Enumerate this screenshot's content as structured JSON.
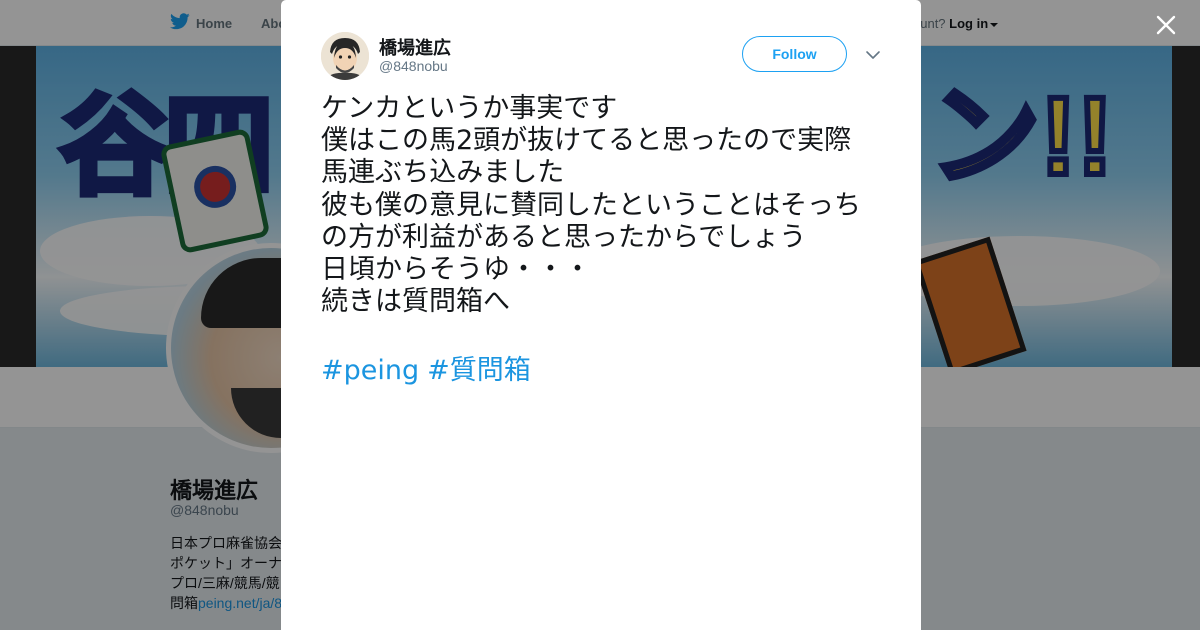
{
  "nav": {
    "home_label": "Home",
    "about_label": "Abo",
    "account_prompt": "ccount?",
    "login_label": "Log in"
  },
  "profile": {
    "name": "橋場進広",
    "handle": "@848nobu",
    "bio_lines": [
      "日本プロ麻雀協会",
      "ポケット」オーナ",
      "プロ/三麻/競馬/競"
    ],
    "bio_prefix": "問箱",
    "bio_link": "peing.net/ja/8"
  },
  "tweet": {
    "author_name": "橋場進広",
    "author_handle": "@848nobu",
    "follow_label": "Follow",
    "lines": [
      "ケンカというか事実です",
      "僕はこの馬2頭が抜けてると思ったので実際",
      "馬連ぶち込みました",
      "彼も僕の意見に賛同したということはそっち",
      "の方が利益があると思ったからでしょう",
      "日頃からそうゆ・・・",
      "続きは質問箱へ"
    ],
    "hashtags": [
      "#peing",
      "#質問箱"
    ]
  },
  "colors": {
    "accent": "#1da1f2",
    "link": "#1b95e0",
    "text": "#14171a",
    "muted": "#657786"
  },
  "icons": {
    "brand": "twitter-bird-icon",
    "close": "close-icon",
    "more": "chevron-down-icon"
  }
}
